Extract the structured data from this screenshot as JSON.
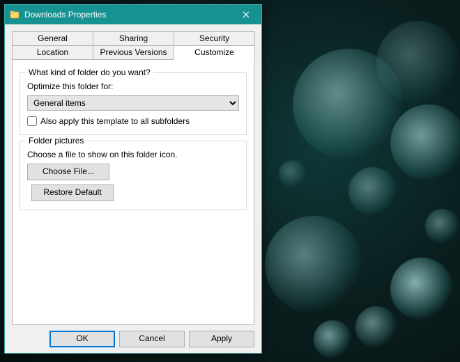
{
  "window": {
    "title": "Downloads Properties"
  },
  "tabs": {
    "row1": [
      "General",
      "Sharing",
      "Security"
    ],
    "row2": [
      "Location",
      "Previous Versions",
      "Customize"
    ],
    "active": "Customize"
  },
  "group_kind": {
    "legend": "What kind of folder do you want?",
    "optimize_label": "Optimize this folder for:",
    "combo_value": "General items",
    "checkbox_label": "Also apply this template to all subfolders"
  },
  "group_pictures": {
    "legend": "Folder pictures",
    "desc": "Choose a file to show on this folder icon.",
    "choose_file": "Choose File...",
    "restore_default": "Restore Default"
  },
  "buttons": {
    "ok": "OK",
    "cancel": "Cancel",
    "apply": "Apply"
  }
}
